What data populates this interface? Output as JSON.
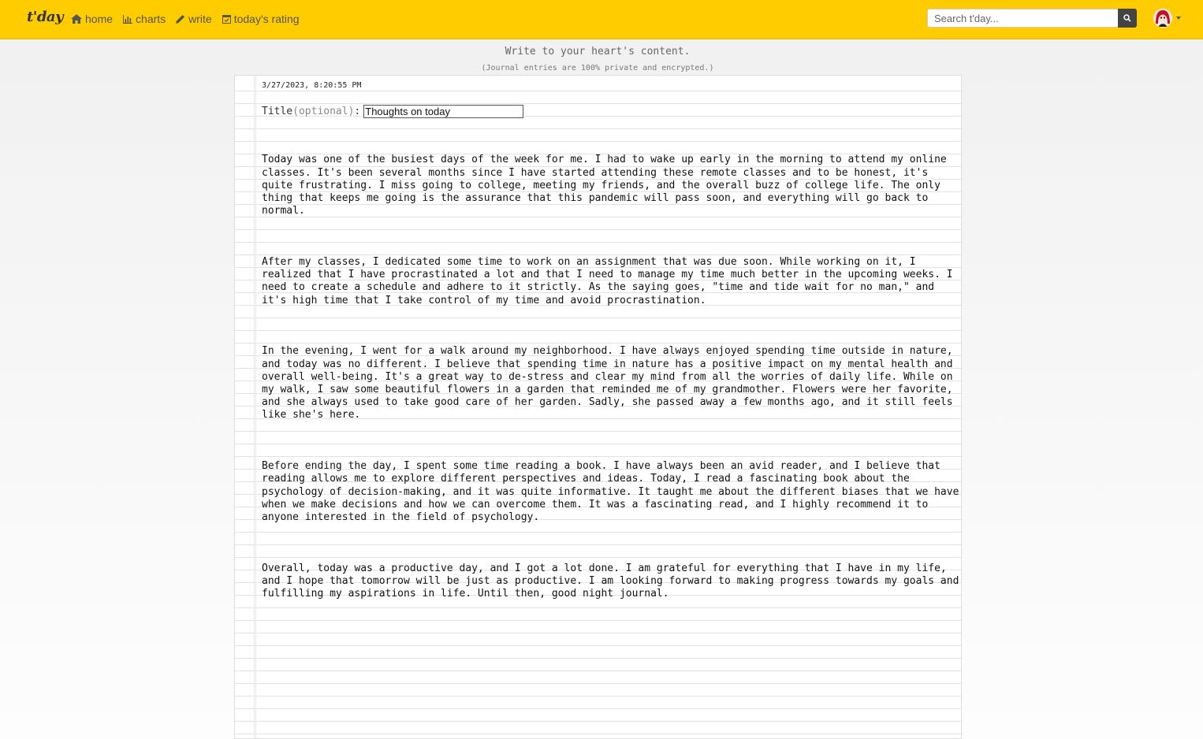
{
  "nav": {
    "brand": "t'day",
    "links": [
      {
        "label": "home",
        "icon": "home-icon"
      },
      {
        "label": "charts",
        "icon": "bar-chart-icon"
      },
      {
        "label": "write",
        "icon": "pencil-icon"
      },
      {
        "label": "today's rating",
        "icon": "calendar-check-icon"
      }
    ],
    "search_placeholder": "Search t'day...",
    "search_icon": "search-icon",
    "avatar_icon": "avatar-icon",
    "accent_color": "#ffcc00"
  },
  "header": {
    "tagline": "Write to your heart's content.",
    "subtag": "(Journal entries are 100% private and encrypted.)"
  },
  "entry": {
    "datestamp": "3/27/2023, 8:20:55 PM",
    "title_label": "Title",
    "title_optional": "(optional)",
    "title_colon": ":",
    "title_value": "Thoughts on today",
    "paragraphs": [
      "Today was one of the busiest days of the week for me. I had to wake up early in the morning to attend my online classes. It's been several months since I have started attending these remote classes and to be honest, it's quite frustrating. I miss going to college, meeting my friends, and the overall buzz of college life. The only thing that keeps me going is the assurance that this pandemic will pass soon, and everything will go back to normal.",
      "After my classes, I dedicated some time to work on an assignment that was due soon. While working on it, I realized that I have procrastinated a lot and that I need to manage my time much better in the upcoming weeks. I need to create a schedule and adhere to it strictly. As the saying goes, \"time and tide wait for no man,\" and it's high time that I take control of my time and avoid procrastination.",
      "In the evening, I went for a walk around my neighborhood. I have always enjoyed spending time outside in nature, and today was no different. I believe that spending time in nature has a positive impact on my mental health and overall well-being. It's a great way to de-stress and clear my mind from all the worries of daily life. While on my walk, I saw some beautiful flowers in a garden that reminded me of my grandmother. Flowers were her favorite, and she always used to take good care of her garden. Sadly, she passed away a few months ago, and it still feels like she's here.",
      "Before ending the day, I spent some time reading a book. I have always been an avid reader, and I believe that reading allows me to explore different perspectives and ideas. Today, I read a fascinating book about the psychology of decision-making, and it was quite informative. It taught me about the different biases that we have when we make decisions and how we can overcome them. It was a fascinating read, and I highly recommend it to anyone interested in the field of psychology.",
      "Overall, today was a productive day, and I got a lot done. I am grateful for everything that I have in my life, and I hope that tomorrow will be just as productive. I am looking forward to making progress towards my goals and fulfilling my aspirations in life. Until then, good night journal."
    ]
  }
}
